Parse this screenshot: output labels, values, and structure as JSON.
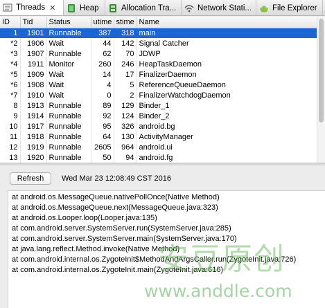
{
  "tabs": [
    {
      "label": "Threads",
      "icon": "threads-icon",
      "closable": true,
      "active": true
    },
    {
      "label": "Heap",
      "icon": "heap-icon",
      "closable": false,
      "active": false
    },
    {
      "label": "Allocation Tra...",
      "icon": "allocation-icon",
      "closable": false,
      "active": false
    },
    {
      "label": "Network Stati...",
      "icon": "wifi-icon",
      "closable": false,
      "active": false
    },
    {
      "label": "File Explorer",
      "icon": "android-icon",
      "closable": false,
      "active": false
    }
  ],
  "threads_table": {
    "columns": [
      "ID",
      "Tid",
      "Status",
      "utime",
      "stime",
      "Name"
    ],
    "selected_index": 0,
    "rows": [
      [
        "1",
        "1901",
        "Runnable",
        "387",
        "318",
        "main"
      ],
      [
        "*2",
        "1906",
        "Wait",
        "44",
        "142",
        "Signal Catcher"
      ],
      [
        "*3",
        "1907",
        "Runnable",
        "62",
        "70",
        "JDWP"
      ],
      [
        "*4",
        "1911",
        "Monitor",
        "260",
        "246",
        "HeapTaskDaemon"
      ],
      [
        "*5",
        "1909",
        "Wait",
        "14",
        "17",
        "FinalizerDaemon"
      ],
      [
        "*6",
        "1908",
        "Wait",
        "4",
        "5",
        "ReferenceQueueDaemon"
      ],
      [
        "*7",
        "1910",
        "Wait",
        "0",
        "2",
        "FinalizerWatchdogDaemon"
      ],
      [
        "8",
        "1913",
        "Runnable",
        "89",
        "129",
        "Binder_1"
      ],
      [
        "9",
        "1914",
        "Runnable",
        "92",
        "124",
        "Binder_2"
      ],
      [
        "10",
        "1917",
        "Runnable",
        "95",
        "326",
        "android.bg"
      ],
      [
        "11",
        "1918",
        "Runnable",
        "64",
        "130",
        "ActivityManager"
      ],
      [
        "12",
        "1919",
        "Runnable",
        "2605",
        "964",
        "android.ui"
      ],
      [
        "13",
        "1920",
        "Runnable",
        "50",
        "94",
        "android.fg"
      ]
    ]
  },
  "refresh_label": "Refresh",
  "timestamp": "Wed Mar 23 12:08:49 CST 2016",
  "stack_trace": [
    "at android.os.MessageQueue.nativePollOnce(Native Method)",
    "at android.os.MessageQueue.next(MessageQueue.java:323)",
    "at android.os.Looper.loop(Looper.java:135)",
    "at com.android.server.SystemServer.run(SystemServer.java:285)",
    "at com.android.server.SystemServer.main(SystemServer.java:170)",
    "at java.lang.reflect.Method.invoke(Native Method)",
    "at com.android.internal.os.ZygoteInit$MethodAndArgsCaller.run(ZygoteInit.java:726)",
    "at com.android.internal.os.ZygoteInit.main(ZygoteInit.java:616)"
  ],
  "watermark": {
    "chinese": "安豆原创",
    "url": "www.anddle.com"
  },
  "colors": {
    "selection": "#1b64d9",
    "android_green": "#8cbf3f",
    "heap_green": "#2e9a3a"
  }
}
